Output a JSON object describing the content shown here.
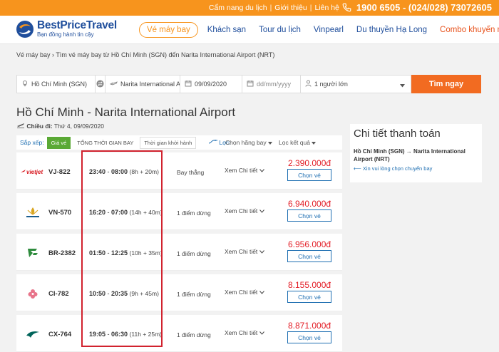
{
  "topbar": {
    "links": [
      "Cẩm nang du lịch",
      "Giới thiệu",
      "Liên hệ"
    ],
    "separator": "|",
    "hotline": "1900 6505 - (024/028) 73072605"
  },
  "header": {
    "logo_name": "BestPriceTravel",
    "logo_tagline": "Bạn đồng hành tin cậy",
    "menu": [
      {
        "label": "Vé máy bay"
      },
      {
        "label": "Khách sạn"
      },
      {
        "label": "Tour du lịch"
      },
      {
        "label": "Vinpearl"
      },
      {
        "label": "Du thuyền Hạ Long"
      },
      {
        "label": "Combo khuyến mại"
      }
    ]
  },
  "breadcrumb": {
    "root": "Vé máy bay",
    "separator": "›",
    "current": "Tìm vé máy bay từ Hồ Chí Minh (SGN) đến Narita International Airport (NRT)"
  },
  "search": {
    "from": "Hồ Chí Minh (SGN)",
    "to": "Narita International Airp",
    "depart_date": "09/09/2020",
    "return_placeholder": "dd/mm/yyyy",
    "passengers": "1 người lớn",
    "button": "Tìm ngay"
  },
  "results": {
    "title": "Hồ Chí Minh - Narita International Airport",
    "depart_label": "Chiều đi:",
    "depart_date": "Thứ 4, 09/09/2020",
    "sort_label": "Sắp xếp:",
    "sort_options": [
      "Giá vé",
      "Tổng thời gian bay",
      "Thời gian khởi hành"
    ],
    "filter_label": "Lọc:",
    "filter_airline": "Chọn hãng bay",
    "filter_result": "Lọc kết quả",
    "flights": [
      {
        "airline": "Vietjet",
        "code": "VJ-822",
        "depart": "23:40",
        "arrive": "08:00",
        "duration": "(8h + 20m)",
        "stops": "Bay thẳng",
        "details": "Xem Chi tiết",
        "price": "2.390.000đ",
        "button": "Chọn vé"
      },
      {
        "airline": "Vietnam Airlines",
        "code": "VN-570",
        "depart": "16:20",
        "arrive": "07:00",
        "duration": "(14h + 40m)",
        "stops": "1 điểm dừng",
        "details": "Xem Chi tiết",
        "price": "6.940.000đ",
        "button": "Chọn vé"
      },
      {
        "airline": "EVA Air",
        "code": "BR-2382",
        "depart": "01:50",
        "arrive": "12:25",
        "duration": "(10h + 35m)",
        "stops": "1 điểm dừng",
        "details": "Xem Chi tiết",
        "price": "6.956.000đ",
        "button": "Chọn vé"
      },
      {
        "airline": "China Airlines",
        "code": "CI-782",
        "depart": "10:50",
        "arrive": "20:35",
        "duration": "(9h + 45m)",
        "stops": "1 điểm dừng",
        "details": "Xem Chi tiết",
        "price": "8.155.000đ",
        "button": "Chọn vé"
      },
      {
        "airline": "Cathay Pacific",
        "code": "CX-764",
        "depart": "19:05",
        "arrive": "06:30",
        "duration": "(11h + 25m)",
        "stops": "1 điểm dừng",
        "details": "Xem Chi tiết",
        "price": "8.871.000đ",
        "button": "Chọn vé"
      }
    ]
  },
  "payment": {
    "title": "Chi tiết thanh toán",
    "route": "Hồ Chí Minh (SGN)  →  Narita International Airport (NRT)",
    "note": "⟵ Xin vui lòng chọn chuyến bay"
  },
  "colors": {
    "brand_orange": "#f7941d",
    "brand_blue": "#1f4e9c",
    "price_red": "#e31c25",
    "highlight_red": "#d1222e",
    "sort_green": "#5aa935"
  }
}
